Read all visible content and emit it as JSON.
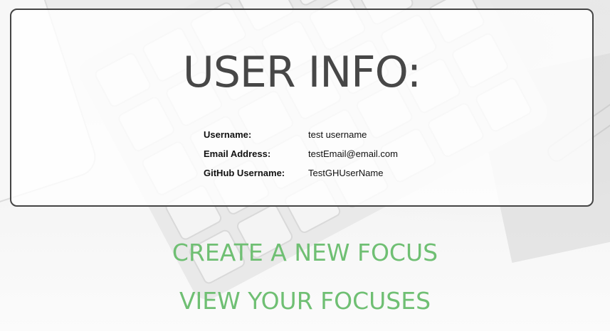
{
  "user_info": {
    "title": "USER INFO:",
    "rows": [
      {
        "label": "Username:",
        "value": "test username"
      },
      {
        "label": "Email Address:",
        "value": "testEmail@email.com"
      },
      {
        "label": "GitHub Username:",
        "value": "TestGHUserName"
      }
    ]
  },
  "actions": {
    "create_label": "CREATE A NEW FOCUS",
    "view_label": "VIEW YOUR FOCUSES"
  },
  "colors": {
    "accent_green": "#6fbf73",
    "title_gray": "#474747",
    "border": "#444444"
  }
}
